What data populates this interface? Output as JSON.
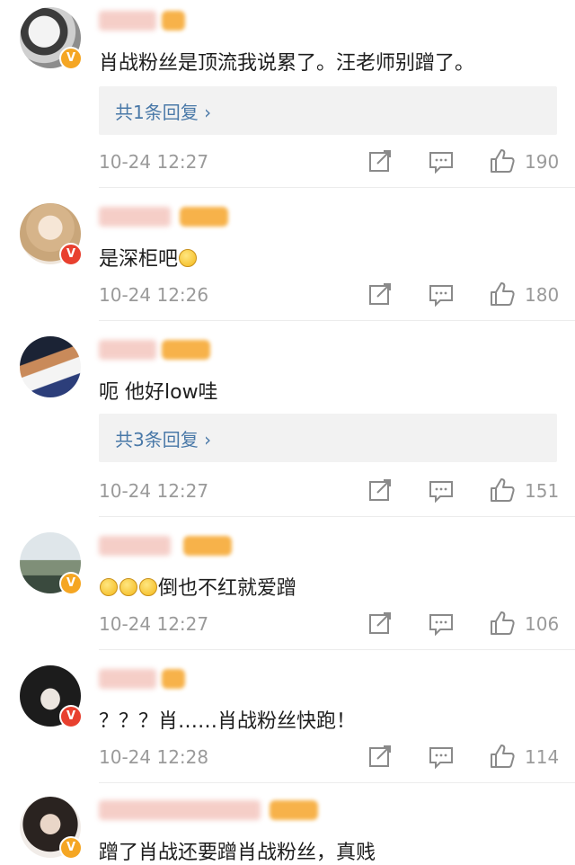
{
  "comments": [
    {
      "text": "肖战粉丝是顶流我说累了。汪老师别蹭了。",
      "reply": "共1条回复 ›",
      "time": "10-24 12:27",
      "likes": "190",
      "badge_color": "#f5a623"
    },
    {
      "text": "是深柜吧",
      "time": "10-24 12:26",
      "likes": "180",
      "badge_color": "#e8402f"
    },
    {
      "text": "呃 他好low哇",
      "reply": "共3条回复 ›",
      "time": "10-24 12:27",
      "likes": "151"
    },
    {
      "text": "倒也不红就爱蹭",
      "time": "10-24 12:27",
      "likes": "106",
      "badge_color": "#f5a623"
    },
    {
      "text": "？？？肖……肖战粉丝快跑！",
      "time": "10-24 12:28",
      "likes": "114",
      "badge_color": "#e8402f"
    },
    {
      "text": "蹭了肖战还要蹭肖战粉丝，真贱",
      "badge_color": "#f5a623"
    }
  ],
  "icons": {
    "share": "share-icon",
    "comment": "comment-icon",
    "like": "thumbs-up-icon",
    "verified": "verified-badge-icon"
  },
  "colors": {
    "link": "#4a79a8",
    "meta": "#9a9a9a",
    "reply_bg": "#f2f2f2"
  }
}
